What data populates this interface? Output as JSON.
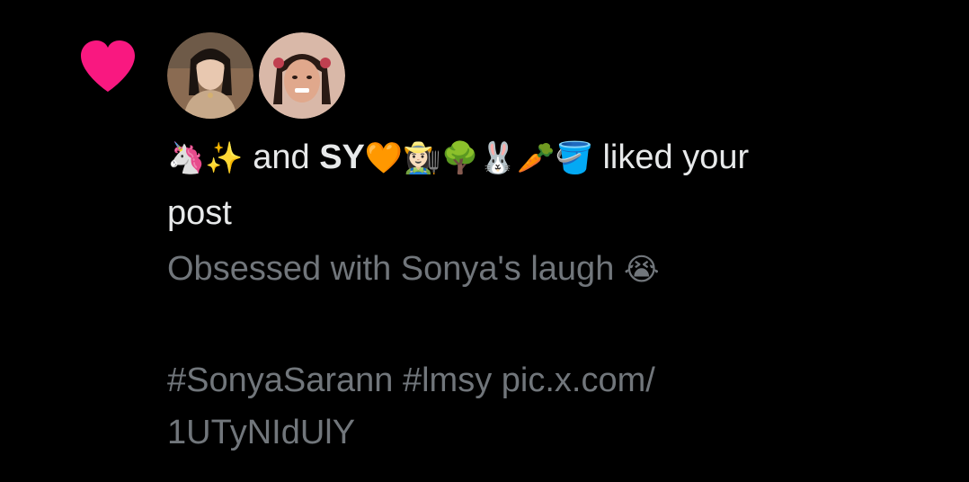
{
  "notification": {
    "type_icon": "heart-icon",
    "accent_color": "#f91880",
    "avatars": [
      {
        "name": "avatar-user-1",
        "bg": "#9c7a60"
      },
      {
        "name": "avatar-user-2",
        "bg": "#b88b78"
      }
    ],
    "actor_1_emoji": "🦄✨",
    "connector": "and",
    "actor_2_name": "SY",
    "actor_2_emoji": "🧡👩🏻‍🌾🌳🐰🥕🪣",
    "action_text": "liked your",
    "action_text_2": "post",
    "post": {
      "text": "Obsessed with Sonya's laugh",
      "text_emoji": "😭",
      "hashtag_1": "#SonyaSarann",
      "hashtag_2": "#lmsy",
      "link_part_1": "pic.x.com/",
      "link_part_2": "1UTyNIdUlY"
    }
  }
}
